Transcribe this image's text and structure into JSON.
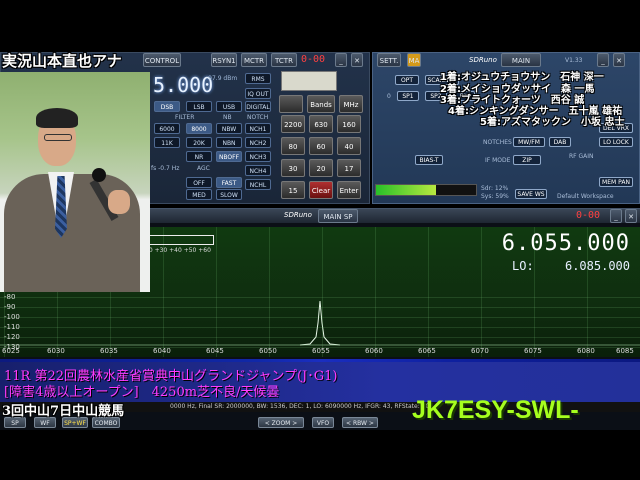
{
  "overlay": {
    "announcer": "実況山本直也アナ",
    "rankings": [
      "1着:オジュウチョウサン　石神 深一",
      "2着:メイショウダッサイ　森 一馬",
      "3着:ブライトクォーツ　西谷 誠",
      "4着:シンキングダンサー　五十嵐 雄祐",
      "5着:アズマタックン　小坂 忠士"
    ],
    "race_line1": "11R 第22回農林水産省賞典中山グランドジャンプ(J･G1)",
    "race_line2": "[障害4歳以上オープン]　4250m芝不良/天候曇",
    "venue": "3回中山7日中山競馬",
    "callsign": "JK7ESY-SWL-"
  },
  "left_window": {
    "buttons_top": [
      "CONTROL",
      "RSYN1",
      "MCTR",
      "TCTR"
    ],
    "frequency": "5.000",
    "dbm": "-97.9 dBm",
    "rms": "RMS",
    "iq_out": "IQ OUT",
    "modes": [
      "DSB",
      "LSB",
      "USB",
      "DIGITAL"
    ],
    "filter_label": "FILTER",
    "nb_label": "NB",
    "notch_label": "NOTCH",
    "filters": [
      "6000",
      "8000",
      "11K",
      "20K"
    ],
    "nb": [
      "NBW",
      "NBN",
      "NR",
      "NBOFF"
    ],
    "notch": [
      "NCH1",
      "NCH2",
      "NCH3",
      "NCHL"
    ],
    "agc_label": "AGC",
    "agc": [
      "OFF",
      "FAST",
      "MED",
      "SLOW"
    ],
    "nch4": "NCH4",
    "fs_text": "fs -0.7 Hz",
    "pad_title": "0-00",
    "pad": {
      "bands": "Bands",
      "mhz": "MHz",
      "keys": [
        "2200",
        "630",
        "160",
        "80",
        "60",
        "40",
        "30",
        "20",
        "17",
        "15",
        "Clear",
        "Enter"
      ]
    }
  },
  "right_window": {
    "sett": "SETT.",
    "ma": "MA",
    "title": "SDRuno",
    "main": "MAIN",
    "version": "V1.33",
    "buttons": [
      "OPT",
      "SCANNER",
      "SP1",
      "SP2",
      "RX",
      "BIAS-T",
      "MW/FM",
      "DAB",
      "ZIP",
      "DEL VRX",
      "LO LOCK",
      "MEM PAN",
      "SAVE WS"
    ],
    "notches": "NOTCHES",
    "if_mode": "IF MODE",
    "rf_gain": "RF GAIN",
    "zero": "0",
    "sdr": "Sdr: 12%",
    "sys": "Sys: 59%",
    "workspace": "Default Workspace",
    "bar_fill": 0.6
  },
  "spectrum": {
    "title": "SDRuno",
    "main_sp": "MAIN SP",
    "seg_display": "0-00",
    "main_freq": "6.055.000",
    "lo_label": "LO:",
    "lo_value": "6.085.000",
    "db_ticks": [
      "-80",
      "-90",
      "-100",
      "-110",
      "-120",
      "-130"
    ],
    "top_scale": "+20 +30 +40 +50 +60",
    "freq_ticks": [
      "6025",
      "6030",
      "6035",
      "6040",
      "6045",
      "6050",
      "6055",
      "6060",
      "6065",
      "6070",
      "6075",
      "6080",
      "6085"
    ],
    "info": "0000 Hz, Final SR: 2000000, BW: 1536, DEC: 1, LO: 6090000 Hz, IFGR: 43, RFState:",
    "info_tail": "202",
    "bottom_buttons": [
      "SP",
      "WF",
      "SP+WF",
      "COMBO",
      "ZOOM",
      "VFO",
      "RBW"
    ]
  }
}
